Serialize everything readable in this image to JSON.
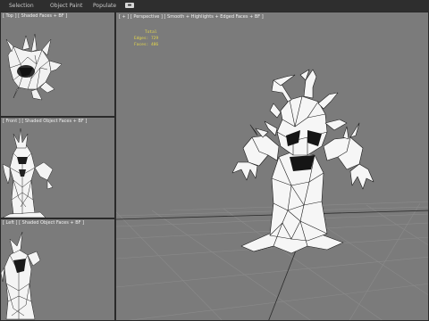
{
  "menubar": {
    "items": [
      {
        "label": "Selection"
      },
      {
        "label": "Object Paint"
      },
      {
        "label": "Populate"
      }
    ],
    "toggle_icon": "display-toggle-icon"
  },
  "viewports": {
    "top": {
      "label": "[ Top ] [ Shaded Faces + BF ]"
    },
    "front": {
      "label": "[ Front ] [ Shaded Object Faces + BF ]"
    },
    "left": {
      "label": "[ Left ] [ Shaded Object Faces + BF ]"
    },
    "perspective": {
      "label": "[ + ] [ Perspective ] [ Smooth + Highlights + Edged Faces + BF ]",
      "stats": {
        "header": "Total",
        "edges": "Edges: 729",
        "faces": "Faces: 486"
      }
    }
  },
  "colors": {
    "background": "#3a3a3a",
    "viewport": "#7b7b7b",
    "grid": "#8a8a8a",
    "grid_axis": "#2b2b2b",
    "mesh_fill": "#f4f4f4",
    "mesh_wire": "#222222",
    "stats_text": "#e6d84a"
  }
}
